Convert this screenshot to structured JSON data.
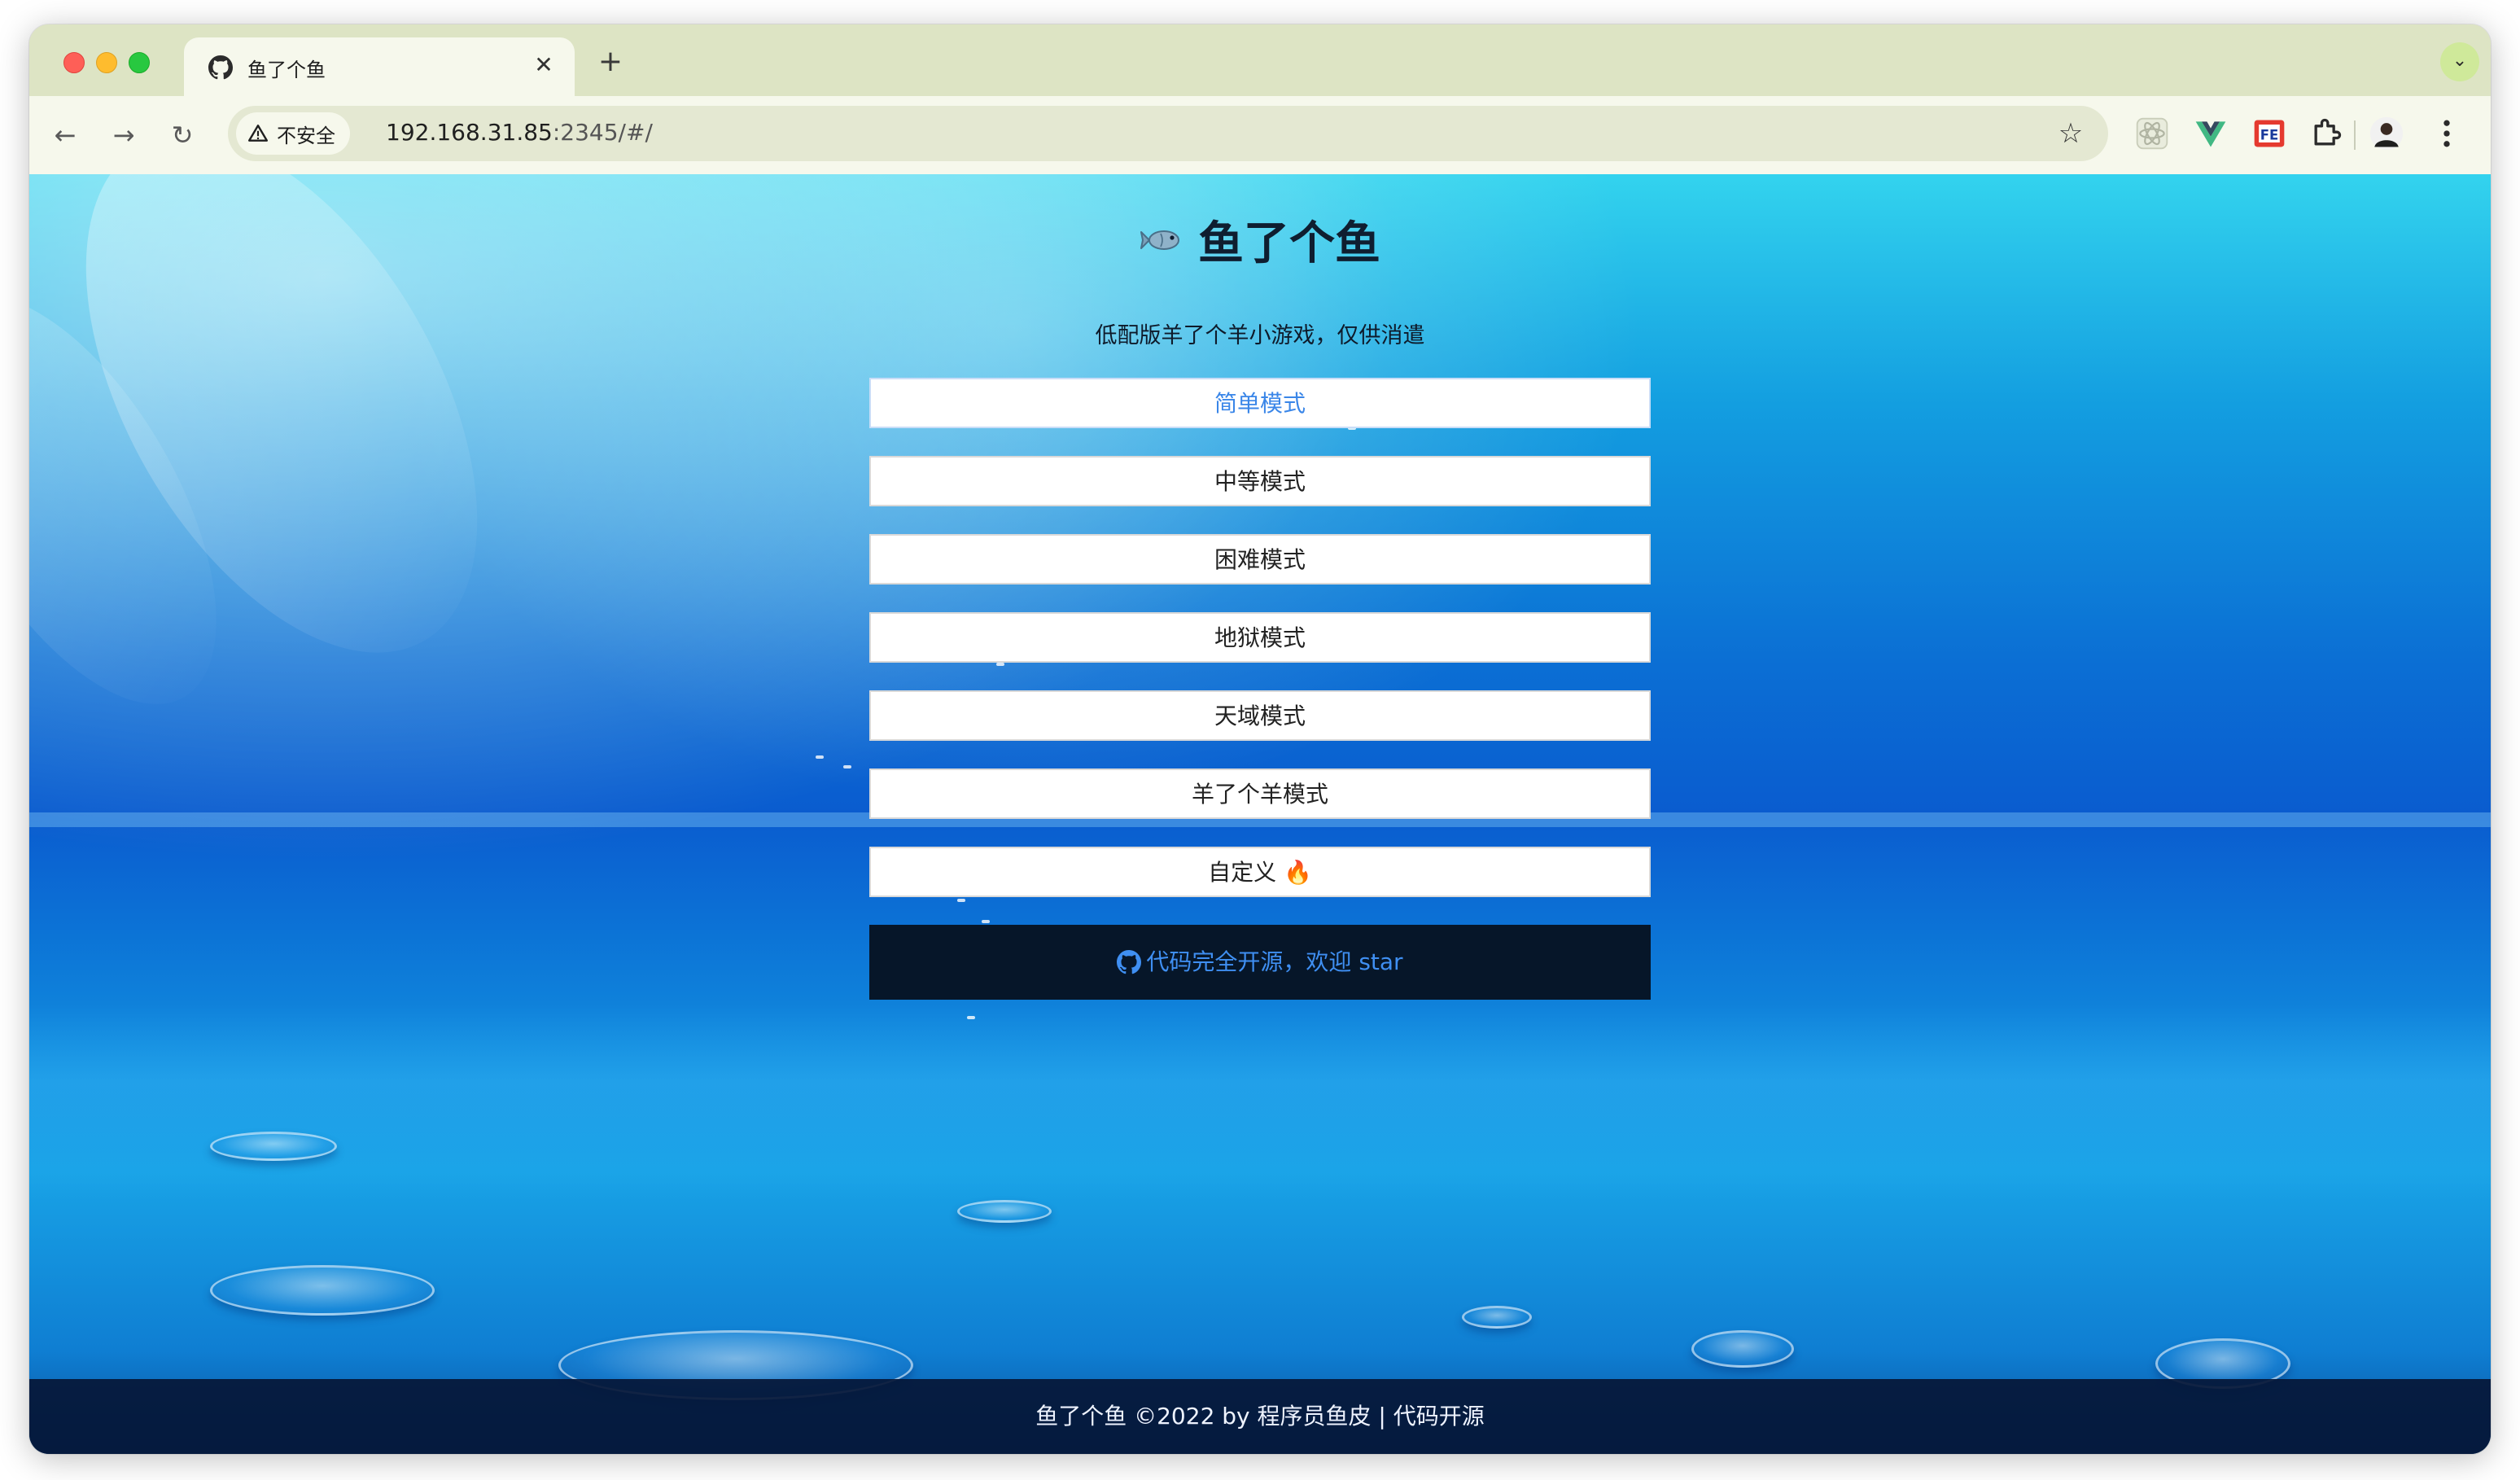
{
  "browser": {
    "tab": {
      "title": "鱼了个鱼",
      "close_glyph": "✕",
      "favicon": "github-octocat-icon"
    },
    "new_tab_glyph": "+",
    "tab_search_glyph": "⌄",
    "nav": {
      "back_glyph": "←",
      "forward_glyph": "→",
      "reload_glyph": "↻"
    },
    "security_label": "不安全",
    "url_host": "192.168.31.85",
    "url_rest": ":2345/#/",
    "bookmark_glyph": "☆",
    "extensions": [
      "react-devtools-icon",
      "vue-devtools-icon",
      "fe-helper-icon",
      "puzzle-extensions-icon",
      "profile-avatar-icon",
      "more-menu-icon"
    ]
  },
  "page": {
    "title": "鱼了个鱼",
    "subtitle": "低配版羊了个羊小游戏，仅供消遣",
    "modes": [
      {
        "label": "简单模式"
      },
      {
        "label": "中等模式"
      },
      {
        "label": "困难模式"
      },
      {
        "label": "地狱模式"
      },
      {
        "label": "天域模式"
      },
      {
        "label": "羊了个羊模式"
      },
      {
        "label": "自定义",
        "emoji": "🔥"
      }
    ],
    "github_text": "代码完全开源，欢迎 star",
    "footer": "鱼了个鱼 ©2022 by 程序员鱼皮 | 代码开源"
  },
  "colors": {
    "accent": "#3a86e8",
    "github_bar": "#061629",
    "title": "#0f1e30"
  }
}
